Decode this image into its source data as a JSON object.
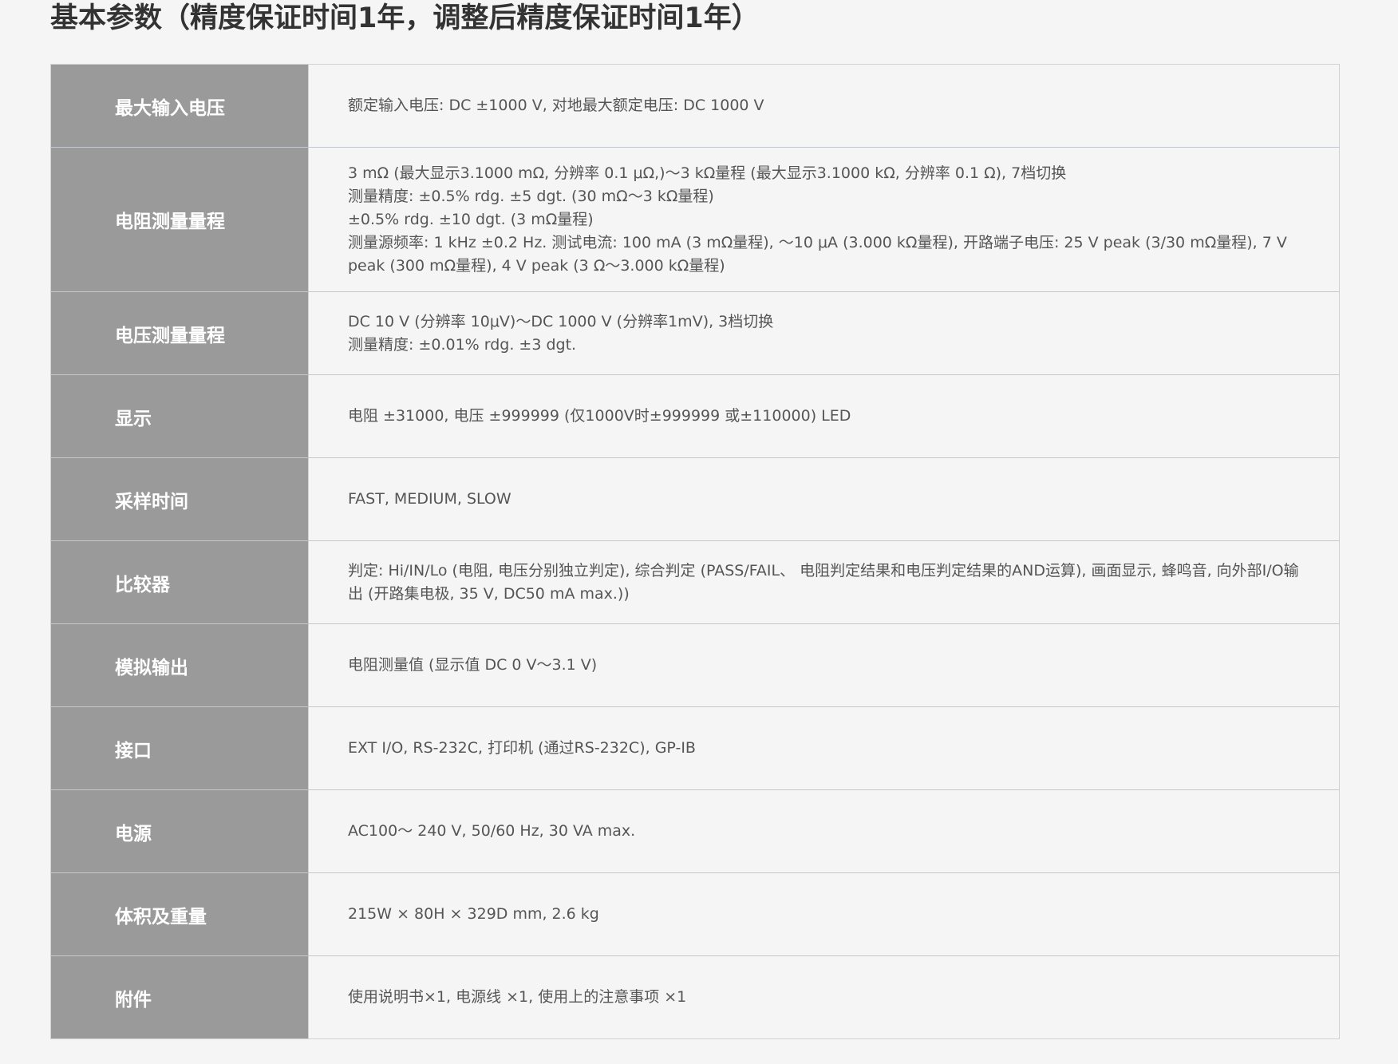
{
  "title": "基本参数（精度保证时间1年，调整后精度保证时间1年）",
  "specs": [
    {
      "label": "最大输入电压",
      "lines": [
        "额定输入电压: DC ±1000 V, 对地最大额定电压: DC 1000 V"
      ]
    },
    {
      "label": "电阻测量量程",
      "lines": [
        "3 mΩ (最大显示3.1000 mΩ, 分辨率 0.1 μΩ,)〜3 kΩ量程 (最大显示3.1000 kΩ, 分辨率 0.1 Ω), 7档切换",
        "测量精度: ±0.5% rdg. ±5 dgt. (30 mΩ〜3 kΩ量程)",
        "±0.5% rdg. ±10 dgt. (3 mΩ量程)",
        "测量源频率: 1 kHz ±0.2 Hz. 测试电流: 100 mA (3 mΩ量程), 〜10 μA (3.000 kΩ量程), 开路端子电压: 25 V peak (3/30 mΩ量程), 7 V peak (300 mΩ量程), 4 V peak (3 Ω〜3.000 kΩ量程)"
      ]
    },
    {
      "label": "电压测量量程",
      "lines": [
        "DC 10 V (分辨率 10μV)〜DC 1000 V (分辨率1mV), 3档切换",
        "测量精度: ±0.01% rdg. ±3 dgt."
      ]
    },
    {
      "label": "显示",
      "lines": [
        "电阻 ±31000, 电压 ±999999 (仅1000V时±999999 或±110000) LED"
      ]
    },
    {
      "label": "采样时间",
      "lines": [
        "FAST, MEDIUM, SLOW"
      ]
    },
    {
      "label": "比较器",
      "lines": [
        "判定: Hi/IN/Lo (电阻, 电压分别独立判定), 综合判定 (PASS/FAIL、 电阻判定结果和电压判定结果的AND运算), 画面显示, 蜂鸣音, 向外部I/O输出 (开路集电极, 35 V, DC50 mA max.))"
      ]
    },
    {
      "label": "模拟输出",
      "lines": [
        "电阻测量值 (显示值 DC 0 V〜3.1 V)"
      ]
    },
    {
      "label": "接口",
      "lines": [
        "EXT I/O, RS-232C, 打印机 (通过RS-232C), GP-IB"
      ]
    },
    {
      "label": "电源",
      "lines": [
        "AC100〜 240 V, 50/60 Hz, 30 VA max."
      ]
    },
    {
      "label": "体积及重量",
      "lines": [
        "215W × 80H × 329D mm, 2.6 kg"
      ]
    },
    {
      "label": "附件",
      "lines": [
        "使用说明书×1, 电源线 ×1, 使用上的注意事项 ×1"
      ]
    }
  ]
}
